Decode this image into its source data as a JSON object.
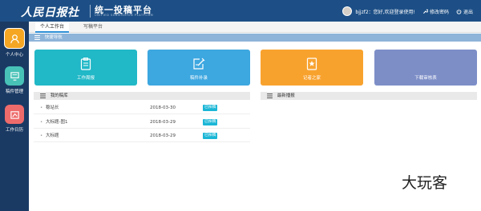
{
  "header": {
    "logo_text": "人民日报社",
    "title": "统一投稿平台",
    "subtitle": "UNIFIED SUBMISSION PLATFORM",
    "welcome": "bjjzf2：您好,欢迎登录使用!",
    "change_password": "修改密码",
    "logout": "退出"
  },
  "sidebar": {
    "items": [
      {
        "label": "个人中心",
        "color": "#f5a623"
      },
      {
        "label": "稿件管理",
        "color": "#48c2b7"
      },
      {
        "label": "工作日历",
        "color": "#ee6b6b"
      }
    ]
  },
  "tabs": [
    {
      "label": "个人工作台",
      "active": true
    },
    {
      "label": "写稿平台",
      "active": false
    }
  ],
  "quick_nav": {
    "title": "快捷导航",
    "tiles": [
      {
        "label": "工作周报",
        "icon": "clipboard-icon",
        "color": "#21b8c7"
      },
      {
        "label": "稿件补录",
        "icon": "edit-document-icon",
        "color": "#3da7e0"
      },
      {
        "label": "记者之家",
        "icon": "star-badge-icon",
        "color": "#f8a22e"
      },
      {
        "label": "下载审核表",
        "icon": "",
        "color": "#7d8ec7"
      }
    ]
  },
  "manuscripts": {
    "title": "我的稿库",
    "rows": [
      {
        "title": "稳站长",
        "date": "2018-03-30",
        "status": "已採稿"
      },
      {
        "title": "大标题-图1",
        "date": "2018-03-29",
        "status": "已採稿"
      },
      {
        "title": "大标题",
        "date": "2018-03-29",
        "status": "已採稿"
      }
    ]
  },
  "latest_report": {
    "title": "最新播报"
  },
  "watermark": "大玩客"
}
